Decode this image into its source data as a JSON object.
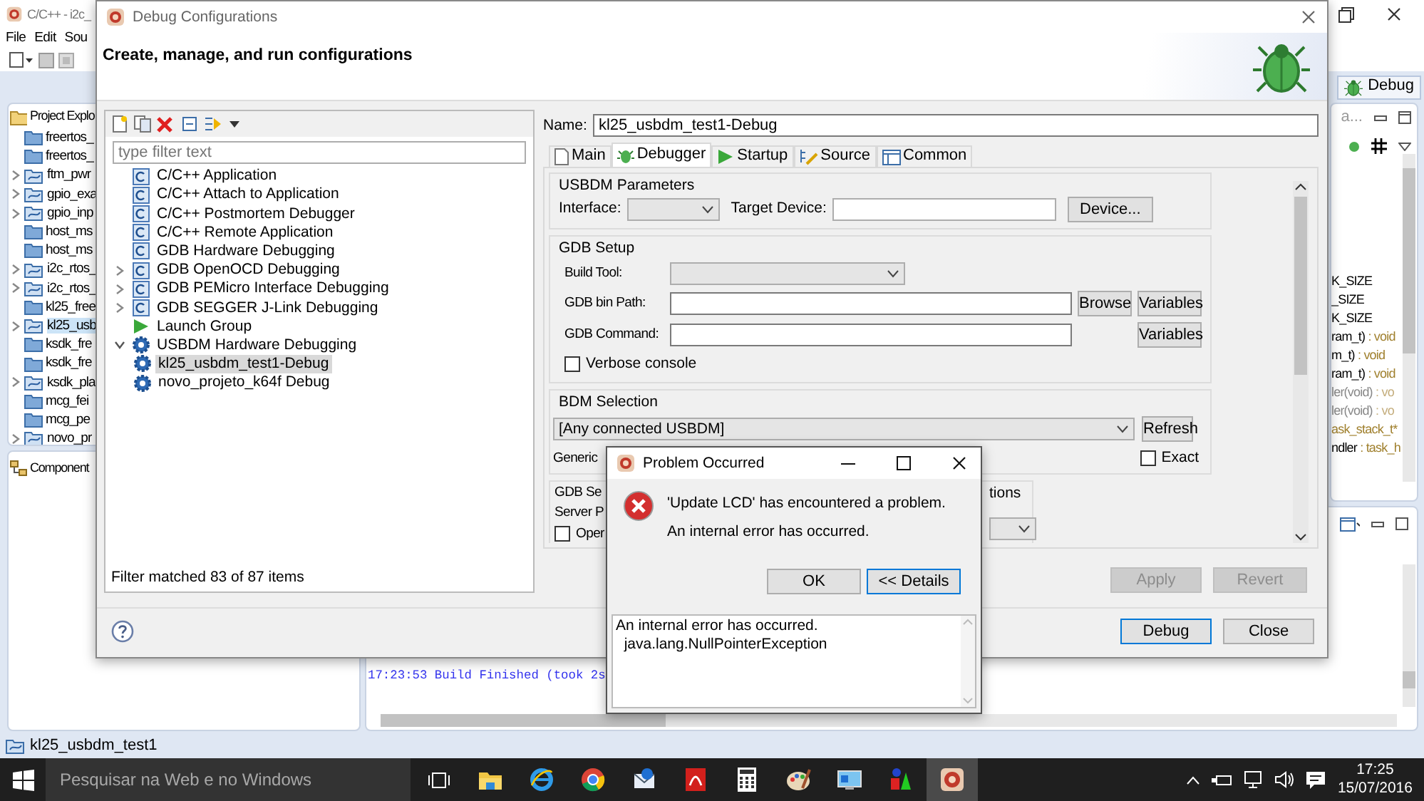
{
  "ide": {
    "title": "C/C++ - i2c_",
    "menu": [
      "File",
      "Edit",
      "Sou"
    ],
    "perspective": "Debug",
    "explorer": {
      "title": "Project Explo",
      "items": [
        {
          "label": "freertos_",
          "kind": "folder",
          "selected": false
        },
        {
          "label": "freertos_",
          "kind": "folder",
          "selected": false
        },
        {
          "label": "ftm_pwr",
          "kind": "project",
          "selected": false
        },
        {
          "label": "gpio_exa",
          "kind": "project",
          "selected": false
        },
        {
          "label": "gpio_inp",
          "kind": "project",
          "selected": false
        },
        {
          "label": "host_ms",
          "kind": "folder",
          "selected": false
        },
        {
          "label": "host_ms",
          "kind": "folder",
          "selected": false
        },
        {
          "label": "i2c_rtos_",
          "kind": "project",
          "selected": false
        },
        {
          "label": "i2c_rtos_",
          "kind": "project",
          "selected": false
        },
        {
          "label": "kl25_free",
          "kind": "folder",
          "selected": false
        },
        {
          "label": "kl25_usb",
          "kind": "project",
          "selected": true
        },
        {
          "label": "ksdk_fre",
          "kind": "folder",
          "selected": false
        },
        {
          "label": "ksdk_fre",
          "kind": "folder",
          "selected": false
        },
        {
          "label": "ksdk_pla",
          "kind": "project",
          "selected": false
        },
        {
          "label": "mcg_fei",
          "kind": "folder",
          "selected": false
        },
        {
          "label": "mcg_pe",
          "kind": "folder",
          "selected": false
        },
        {
          "label": "novo_pr",
          "kind": "project",
          "selected": false
        }
      ]
    },
    "components_title": "Component",
    "outline": {
      "title": "a...",
      "lines": [
        {
          "name": "K_SIZE",
          "muted": false
        },
        {
          "name": "_SIZE",
          "muted": false
        },
        {
          "name": "K_SIZE",
          "muted": false
        },
        {
          "name": "ram_t)",
          "type": " : void",
          "muted": false
        },
        {
          "name": "m_t)",
          "type": " : void",
          "muted": false
        },
        {
          "name": "ram_t)",
          "type": " : void",
          "muted": false
        },
        {
          "name": "ler(void)",
          "type": " : vo",
          "muted": true
        },
        {
          "name": "ler(void)",
          "type": " : vo",
          "muted": true
        },
        {
          "type": "ask_stack_t*",
          "muted": false
        },
        {
          "name": "ndler",
          "type": " : task_h",
          "muted": false
        }
      ]
    },
    "console_line": "17:23:53 Build Finished (took 2s",
    "status": "kl25_usbdm_test1"
  },
  "debug_dialog": {
    "title": "Debug Configurations",
    "header": "Create, manage, and run configurations",
    "filter_placeholder": "type filter text",
    "tree": [
      {
        "label": "C/C++ Application",
        "kind": "c",
        "selected": false
      },
      {
        "label": "C/C++ Attach to Application",
        "kind": "c",
        "selected": false
      },
      {
        "label": "C/C++ Postmortem Debugger",
        "kind": "c",
        "selected": false
      },
      {
        "label": "C/C++ Remote Application",
        "kind": "c",
        "selected": false
      },
      {
        "label": "GDB Hardware Debugging",
        "kind": "c",
        "selected": false
      },
      {
        "label": "GDB OpenOCD Debugging",
        "kind": "c",
        "expanded": false,
        "selected": false
      },
      {
        "label": "GDB PEMicro Interface Debugging",
        "kind": "c",
        "expanded": false,
        "selected": false
      },
      {
        "label": "GDB SEGGER J-Link Debugging",
        "kind": "c",
        "expanded": false,
        "selected": false
      },
      {
        "label": "Launch Group",
        "kind": "launch",
        "selected": false
      },
      {
        "label": "USBDM Hardware Debugging",
        "kind": "gear",
        "expanded": true,
        "selected": false,
        "children": [
          {
            "label": "kl25_usbdm_test1-Debug",
            "kind": "gear",
            "selected": true
          },
          {
            "label": "novo_projeto_k64f Debug",
            "kind": "gear",
            "selected": false
          }
        ]
      }
    ],
    "filter_status": "Filter matched 83 of 87 items",
    "name_label": "Name:",
    "name_value": "kl25_usbdm_test1-Debug",
    "tabs": [
      {
        "label": "Main",
        "kind": "main",
        "selected": false
      },
      {
        "label": "Debugger",
        "kind": "debugger",
        "selected": true
      },
      {
        "label": "Startup",
        "kind": "startup",
        "selected": false
      },
      {
        "label": "Source",
        "kind": "source",
        "selected": false
      },
      {
        "label": "Common",
        "kind": "common",
        "selected": false
      }
    ],
    "usbdm_parameters": {
      "title": "USBDM Parameters",
      "interface_label": "Interface:",
      "target_label": "Target Device:",
      "device_button": "Device..."
    },
    "gdb_setup": {
      "title": "GDB Setup",
      "build_tool_label": "Build Tool:",
      "bin_path_label": "GDB bin Path:",
      "browse_button": "Browse",
      "bin_variables_button": "Variables",
      "command_label": "GDB Command:",
      "command_variables_button": "Variables",
      "verbose": {
        "label": "Verbose console",
        "checked": false
      }
    },
    "bdm_selection": {
      "title": "BDM Selection",
      "device": "[Any connected USBDM]",
      "refresh_button": "Refresh",
      "generic_label": "Generic",
      "exact": {
        "label": "Exact",
        "checked": false
      }
    },
    "gdb_server": {
      "title": "GDB Se",
      "port_label": "Server P",
      "open": {
        "label": "Oper",
        "checked": false
      },
      "options_title": "tions"
    },
    "apply_button": {
      "label": "Apply",
      "disabled": true
    },
    "revert_button": {
      "label": "Revert",
      "disabled": true
    },
    "debug_button": "Debug",
    "close_button": "Close"
  },
  "problem_dialog": {
    "title": "Problem Occurred",
    "message": "'Update LCD' has encountered a problem.",
    "detail_message": "An internal error has occurred.",
    "ok_button": "OK",
    "details_button": "<< Details",
    "details_lines": [
      "An internal error has occurred.",
      "  java.lang.NullPointerException"
    ]
  },
  "taskbar": {
    "search_placeholder": "Pesquisar na Web e no Windows",
    "apps": [
      {
        "kind": "folder",
        "selected": false
      },
      {
        "kind": "ie",
        "selected": false
      },
      {
        "kind": "chrome",
        "selected": false
      },
      {
        "kind": "mail",
        "selected": false
      },
      {
        "kind": "pdf",
        "selected": false
      },
      {
        "kind": "calc",
        "selected": false
      },
      {
        "kind": "paint",
        "selected": false
      },
      {
        "kind": "monitor",
        "selected": false
      },
      {
        "kind": "shapes",
        "selected": false
      },
      {
        "kind": "eclipse",
        "selected": true
      }
    ],
    "time": "17:25",
    "date": "15/07/2016"
  }
}
